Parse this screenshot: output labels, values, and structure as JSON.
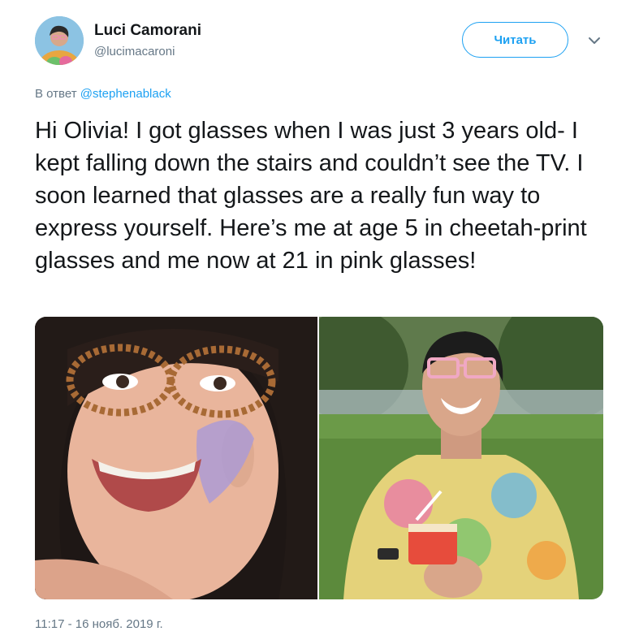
{
  "tweet": {
    "author": {
      "display_name": "Luci Camorani",
      "handle": "@lucimacaroni"
    },
    "follow_label": "Читать",
    "reply_prefix": "В ответ",
    "reply_to": "@stephenablack",
    "text": "Hi Olivia! I got glasses when I was just 3 years old- I kept falling down the stairs and couldn’t see the TV. I soon learned that glasses are a really fun way to express yourself. Here’s me at age 5 in cheetah-print glasses and me now at 21 in pink glasses!",
    "timestamp": "11:17 - 16 нояб. 2019 г.",
    "photos": [
      {
        "subject": "child in cheetah-print glasses with face paint"
      },
      {
        "subject": "young adult in pink glasses holding ice cream cup in a park"
      }
    ]
  },
  "colors": {
    "accent": "#1da1f2",
    "text_primary": "#14171a",
    "text_secondary": "#657786"
  },
  "icons": {
    "more": "chevron-down-icon"
  }
}
